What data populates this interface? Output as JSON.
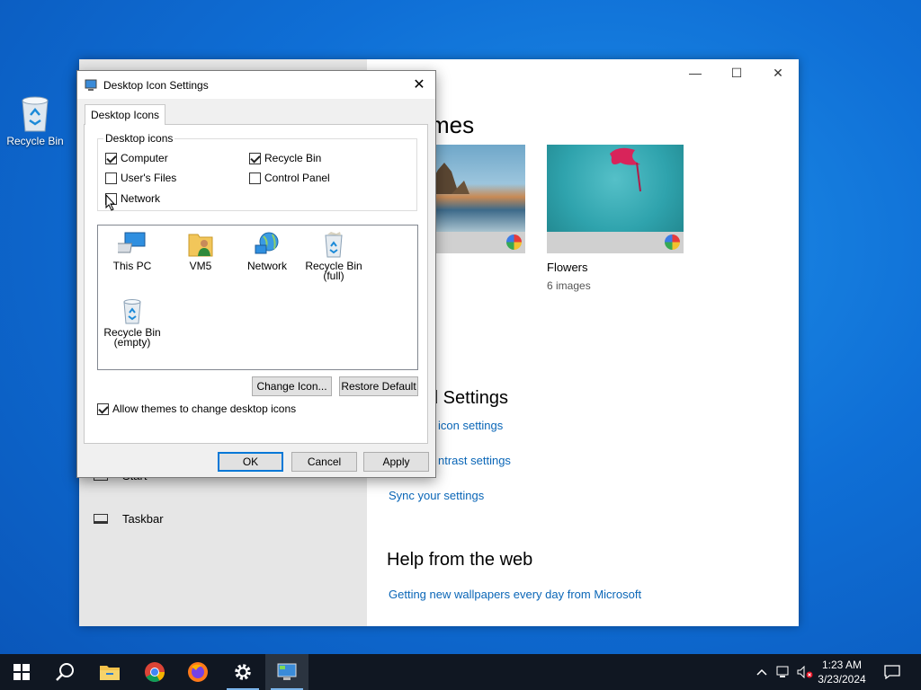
{
  "desktop": {
    "recycle_bin_label": "Recycle Bin"
  },
  "settings_window": {
    "sidebar_items": [
      {
        "label": "Start"
      },
      {
        "label": "Taskbar"
      }
    ],
    "themes_heading": "mes",
    "themes": [
      {
        "name": "s 10",
        "sub": ""
      },
      {
        "name": "Flowers",
        "sub": "6 images"
      }
    ],
    "related_heading": "d Settings",
    "related_links": [
      "icon settings",
      "ntrast settings",
      "Sync your settings"
    ],
    "help_heading": "Help from the web",
    "help_link": "Getting new wallpapers every day from Microsoft"
  },
  "dialog": {
    "title": "Desktop Icon Settings",
    "tab_label": "Desktop Icons",
    "group_label": "Desktop icons",
    "checkboxes": [
      {
        "label": "Computer",
        "checked": true
      },
      {
        "label": "Recycle Bin",
        "checked": true
      },
      {
        "label": "User's Files",
        "checked": false
      },
      {
        "label": "Control Panel",
        "checked": false
      },
      {
        "label": "Network",
        "checked": false
      }
    ],
    "icons": [
      {
        "label": "This PC"
      },
      {
        "label": "VM5"
      },
      {
        "label": "Network"
      },
      {
        "label": "Recycle Bin\n(full)"
      },
      {
        "label": "Recycle Bin\n(empty)"
      }
    ],
    "change_icon_label": "Change Icon...",
    "restore_default_label": "Restore Default",
    "allow_themes_label": "Allow themes to change desktop icons",
    "allow_themes_checked": true,
    "ok_label": "OK",
    "cancel_label": "Cancel",
    "apply_label": "Apply"
  },
  "taskbar": {
    "time": "1:23 AM",
    "date": "3/23/2024",
    "apps": [
      "start-icon",
      "search-icon",
      "file-explorer-icon",
      "chrome-icon",
      "firefox-icon",
      "settings-gear-icon",
      "desktop-icon-settings-icon"
    ]
  },
  "colors": {
    "accent": "#0078d7",
    "link": "#0a66b7",
    "taskbar": "#101722"
  }
}
